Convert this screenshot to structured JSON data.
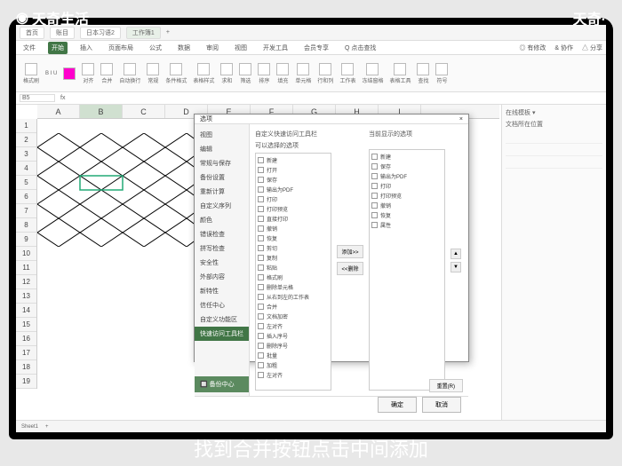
{
  "watermark": {
    "left": "天奇生活",
    "right": "天奇·"
  },
  "subtitle": "找到合并按钮点击中间添加",
  "tabs": [
    "首页",
    "账目",
    "日本习语2",
    "工作簿1"
  ],
  "ribbon_tabs": [
    "文件",
    "开始",
    "插入",
    "页面布局",
    "公式",
    "数据",
    "审阅",
    "视图",
    "开发工具",
    "会员专享",
    "Q 点击查找"
  ],
  "ribbon_right": [
    "◎ 有修改",
    "& 协作",
    "△ 分享"
  ],
  "toolbar_groups": [
    "格式刷",
    "B I U",
    "A",
    "对齐",
    "合并",
    "自动换行",
    "常规",
    "条件格式",
    "表格样式",
    "求和",
    "筛选",
    "排序",
    "填充",
    "单元格",
    "行和列",
    "工作表",
    "冻结窗格",
    "表格工具",
    "查找",
    "符号"
  ],
  "namebox_value": "B5",
  "columns": [
    "A",
    "B",
    "C",
    "D",
    "E",
    "F",
    "G",
    "H",
    "I"
  ],
  "selected_col": "B",
  "rows_visible": 19,
  "sidepanel": {
    "title": "在线模板 ▾",
    "search": "文档所在位置"
  },
  "statusbar": {
    "sheet": "Sheet1"
  },
  "dialog": {
    "title": "选项",
    "close": "×",
    "categories": [
      "视图",
      "编辑",
      "常规与保存",
      "备份设置",
      "重新计算",
      "自定义序列",
      "颜色",
      "错误检查",
      "拼写检查",
      "安全性",
      "外部内容",
      "新特性",
      "信任中心",
      "自定义功能区",
      "快速访问工具栏"
    ],
    "selected_category": "快速访问工具栏",
    "backup": "🔲 备份中心",
    "left_list_title": "自定义快速访问工具栏",
    "left_sub": "可以选择的选项",
    "right_list_title": "当前显示的选项",
    "available": [
      "新建",
      "打开",
      "保存",
      "输出为PDF",
      "打印",
      "打印预览",
      "直接打印",
      "撤销",
      "恢复",
      "剪切",
      "复制",
      "粘贴",
      "格式刷",
      "删除单元格",
      "从右到左的工作表",
      "合并",
      "文档加密",
      "左对齐",
      "插入序号",
      "删除序号",
      "批量",
      "加粗",
      "左对齐"
    ],
    "current": [
      "新建",
      "保存",
      "输出为PDF",
      "打印",
      "打印预览",
      "撤销",
      "恢复",
      "属性"
    ],
    "add_btn": "添加>>",
    "remove_btn": "<<删除",
    "up": "▲",
    "down": "▼",
    "reset": "重置(R)",
    "ok": "确定",
    "cancel": "取消"
  }
}
